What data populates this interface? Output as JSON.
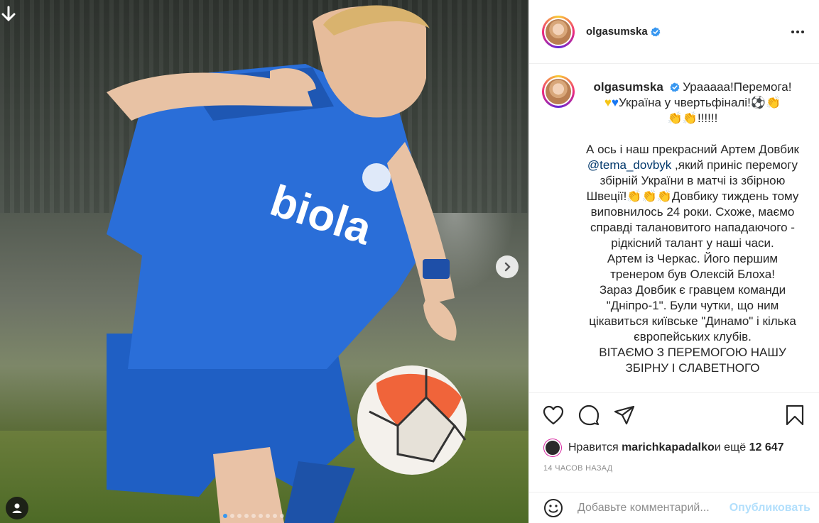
{
  "post": {
    "username": "olgasumska",
    "caption_intro": "Урааааа!Перемога!",
    "caption_line2": "Україна у чвертьфіналі!⚽👏",
    "caption_line3": "👏👏!!!!!!",
    "para_before_mention": "А ось і наш прекрасний Артем Довбик ",
    "mention": "@tema_dovbyk",
    "para_after_mention": " ,який приніс перемогу збірній України в матчі із збірною Швеції!👏👏👏Довбику тиждень тому виповнилось 24 роки. Схоже, маємо справді талановитого нападаючого - рідкісний талант у наші часи.",
    "para2": "Артем із Черкас. Його першим тренером був Олексій Блоха!",
    "para3": "Зараз Довбик є гравцем команди \"Дніпро-1\". Були чутки, що ним цікавиться київське \"Динамо\" і кілька європейських клубів.",
    "para4": "ВІТАЄМО З ПЕРЕМОГОЮ НАШУ ЗБІРНУ І СЛАВЕТНОГО"
  },
  "likes": {
    "prefix": "Нравится ",
    "user": "marichkapadalko",
    "middle": " и ещё ",
    "count": "12 647"
  },
  "time_ago": "14 ЧАСОВ НАЗАД",
  "comment_box": {
    "placeholder": "Добавьте комментарий...",
    "publish_label": "Опубликовать"
  },
  "image": {
    "jersey_text": "biola"
  },
  "carousel": {
    "count": 9,
    "active_index": 0
  },
  "colors": {
    "accent": "#0095f6",
    "publish_disabled": "#b2dffc",
    "secondary_text": "#8e8e8e",
    "link": "#00376b"
  },
  "icons": [
    "download-arrow-icon",
    "chevron-right-icon",
    "user-tag-icon",
    "verified-badge-icon",
    "more-options-icon",
    "heart-icon",
    "comment-icon",
    "share-icon",
    "bookmark-icon",
    "emoji-icon"
  ]
}
